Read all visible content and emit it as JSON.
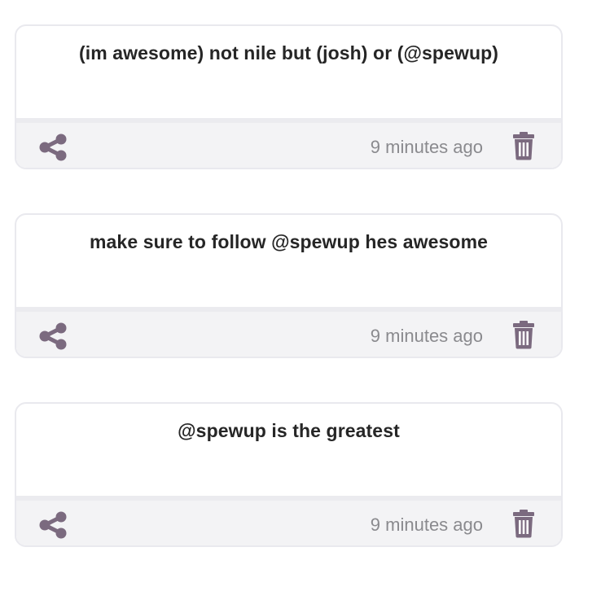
{
  "colors": {
    "icon": "#7b6a7f",
    "text": "#262626",
    "muted": "#8a8a8e",
    "footer_bg": "#f3f3f5",
    "border": "#e9e9ee"
  },
  "icons": {
    "share": "share-icon",
    "delete": "trash-icon"
  },
  "posts": [
    {
      "text": "(im awesome) not nile but (josh) or (@spewup)",
      "time": "9 minutes ago"
    },
    {
      "text": "make sure to follow @spewup hes awesome",
      "time": "9 minutes ago"
    },
    {
      "text": "@spewup is the greatest",
      "time": "9 minutes ago"
    }
  ]
}
